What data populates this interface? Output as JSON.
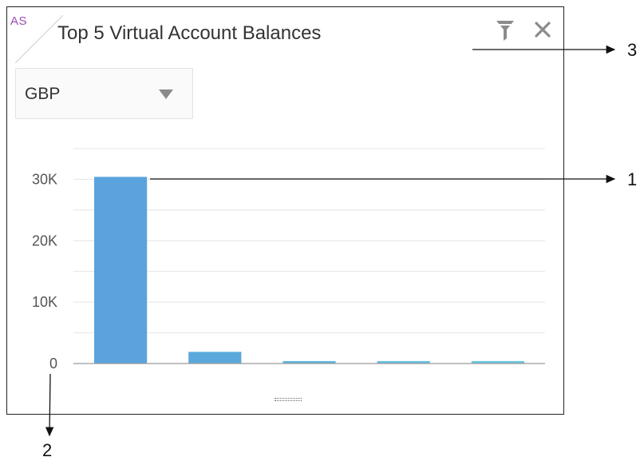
{
  "widget": {
    "corner_tag": "AS",
    "title": "Top 5 Virtual Account Balances",
    "icons": {
      "filter": "filter-icon",
      "close": "close-icon"
    },
    "currency_select": {
      "selected": "GBP"
    }
  },
  "chart_data": {
    "type": "bar",
    "categories": [
      "",
      "",
      "",
      "",
      ""
    ],
    "values": [
      30400,
      1900,
      400,
      400,
      400
    ],
    "ylim": [
      0,
      35000
    ],
    "yticks": [
      0,
      10000,
      20000,
      30000
    ],
    "ytick_labels": [
      "0",
      "10K",
      "20K",
      "30K"
    ],
    "title": "",
    "xlabel": "",
    "ylabel": "",
    "grid": true,
    "colors": [
      "#5ba3dc",
      "#5ba8dc",
      "#60b4dd",
      "#65bedd",
      "#6ac6dd"
    ]
  },
  "callouts": {
    "one": "1",
    "two": "2",
    "three": "3"
  }
}
